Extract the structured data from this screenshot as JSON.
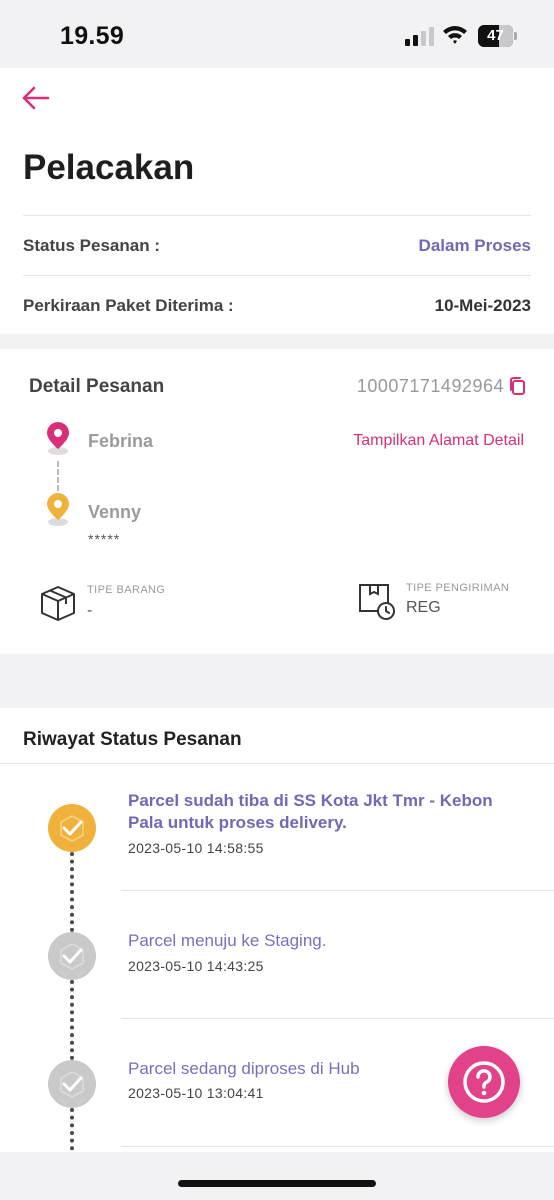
{
  "status_bar": {
    "time": "19.59",
    "battery": "47"
  },
  "page": {
    "title": "Pelacakan"
  },
  "summary": {
    "status_label": "Status Pesanan :",
    "status_value": "Dalam Proses",
    "eta_label": "Perkiraan Paket Diterima :",
    "eta_value": "10-Mei-2023"
  },
  "detail": {
    "title": "Detail Pesanan",
    "order_number": "10007171492964",
    "sender_name": "Febrina",
    "receiver_name": "Venny",
    "receiver_masked": "*****",
    "show_address_link": "Tampilkan Alamat Detail",
    "item_type_label": "TIPE BARANG",
    "item_type_value": "-",
    "shipping_type_label": "TIPE PENGIRIMAN",
    "shipping_type_value": "REG"
  },
  "history": {
    "title": "Riwayat Status Pesanan",
    "items": [
      {
        "title": "Parcel sudah tiba di SS Kota Jkt Tmr - Kebon Pala untuk proses delivery.",
        "time": "2023-05-10 14:58:55"
      },
      {
        "title": "Parcel menuju ke Staging.",
        "time": "2023-05-10 14:43:25"
      },
      {
        "title": "Parcel sedang diproses di Hub",
        "time": "2023-05-10 13:04:41"
      }
    ]
  },
  "colors": {
    "accent": "#d92f7b",
    "status_purple": "#7467b3",
    "active_step": "#f0b23d",
    "inactive_step": "#c9c9c9",
    "help_button": "#e2428a"
  },
  "icons": {
    "back": "arrow-left-icon",
    "copy": "copy-icon",
    "sender": "location-pin-icon",
    "receiver": "location-pin-icon",
    "item_type": "box-icon",
    "shipping_type": "box-clock-icon",
    "step": "check-icon",
    "help": "question-mark-icon"
  }
}
